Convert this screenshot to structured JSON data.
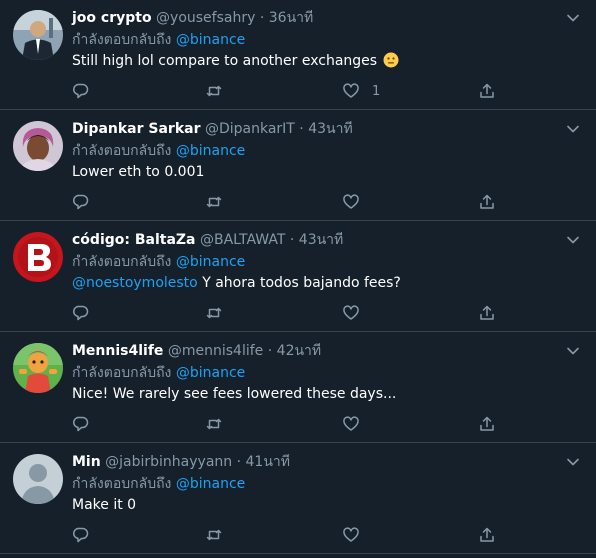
{
  "tweets": [
    {
      "name": "joo crypto",
      "handle": "@yousefsahry",
      "time": "36นาที",
      "reply_prefix": "กำลังตอบกลับถึง",
      "reply_to": "@binance",
      "text": "Still high lol compare to another exchanges",
      "text_mention": "",
      "likes": "1"
    },
    {
      "name": "Dipankar Sarkar",
      "handle": "@DipankarIT",
      "time": "43นาที",
      "reply_prefix": "กำลังตอบกลับถึง",
      "reply_to": "@binance",
      "text": "Lower eth to 0.001",
      "text_mention": "",
      "likes": ""
    },
    {
      "name": "código: BaltaZa",
      "handle": "@BALTAWAT",
      "time": "43นาที",
      "reply_prefix": "กำลังตอบกลับถึง",
      "reply_to": "@binance",
      "text": " Y ahora todos bajando fees?",
      "text_mention": "@noestoymolesto",
      "likes": ""
    },
    {
      "name": "Mennis4life",
      "handle": "@mennis4life",
      "time": "42นาที",
      "reply_prefix": "กำลังตอบกลับถึง",
      "reply_to": "@binance",
      "text": "Nice! We rarely see fees lowered these days...",
      "text_mention": "",
      "likes": ""
    },
    {
      "name": "Min",
      "handle": "@jabirbinhayyann",
      "time": "41นาที",
      "reply_prefix": "กำลังตอบกลับถึง",
      "reply_to": "@binance",
      "text": "Make it 0",
      "text_mention": "",
      "likes": ""
    }
  ],
  "separator": "·",
  "colors": {
    "background": "#15202b",
    "border": "#38444d",
    "muted": "#8899a6",
    "accent": "#1da1f2"
  },
  "icons": {
    "reply": "reply-icon",
    "retweet": "retweet-icon",
    "like": "heart-icon",
    "share": "share-icon",
    "more": "chevron-down-icon"
  }
}
